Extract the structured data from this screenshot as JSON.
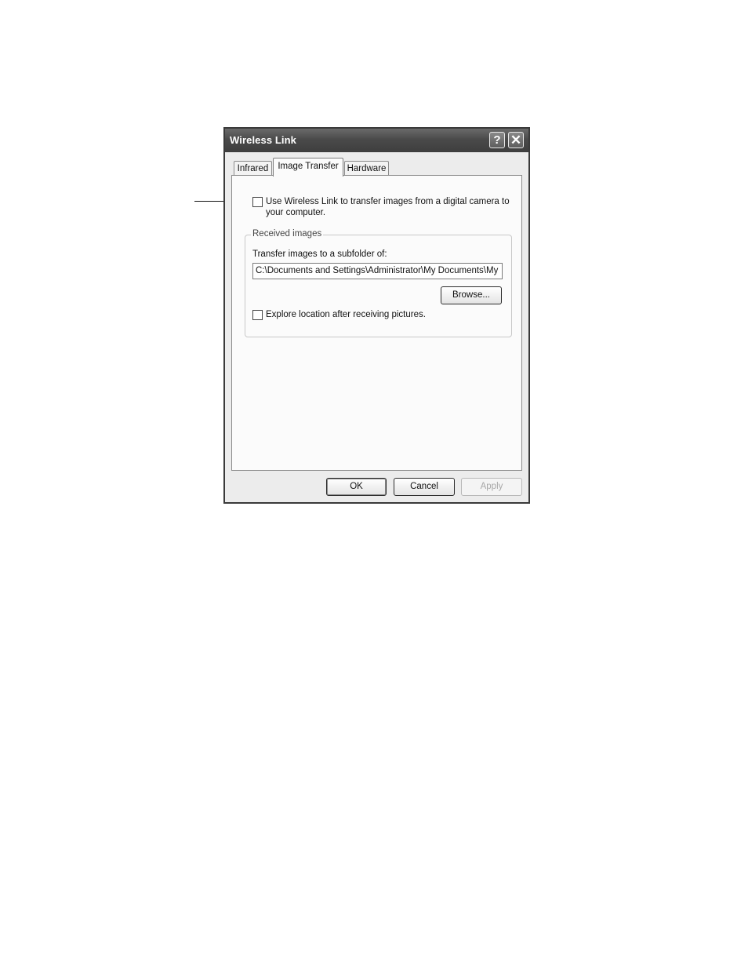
{
  "window": {
    "title": "Wireless Link",
    "help_glyph": "?",
    "close_glyph": "✕"
  },
  "tabs": [
    {
      "label": "Infrared",
      "selected": false
    },
    {
      "label": "Image Transfer",
      "selected": true
    },
    {
      "label": "Hardware",
      "selected": false
    }
  ],
  "image_transfer": {
    "use_wireless_link": {
      "label_line1": "Use Wireless Link to transfer images from a digital camera to",
      "label_line2": "your computer.",
      "checked": false
    },
    "received_images": {
      "group_label": "Received images",
      "transfer_label": "Transfer images to a subfolder of:",
      "path_value": "C:\\Documents and Settings\\Administrator\\My Documents\\My",
      "browse_label": "Browse...",
      "explore_label": "Explore location after receiving pictures.",
      "explore_checked": false
    }
  },
  "buttons": {
    "ok": "OK",
    "cancel": "Cancel",
    "apply": "Apply",
    "apply_enabled": false
  }
}
